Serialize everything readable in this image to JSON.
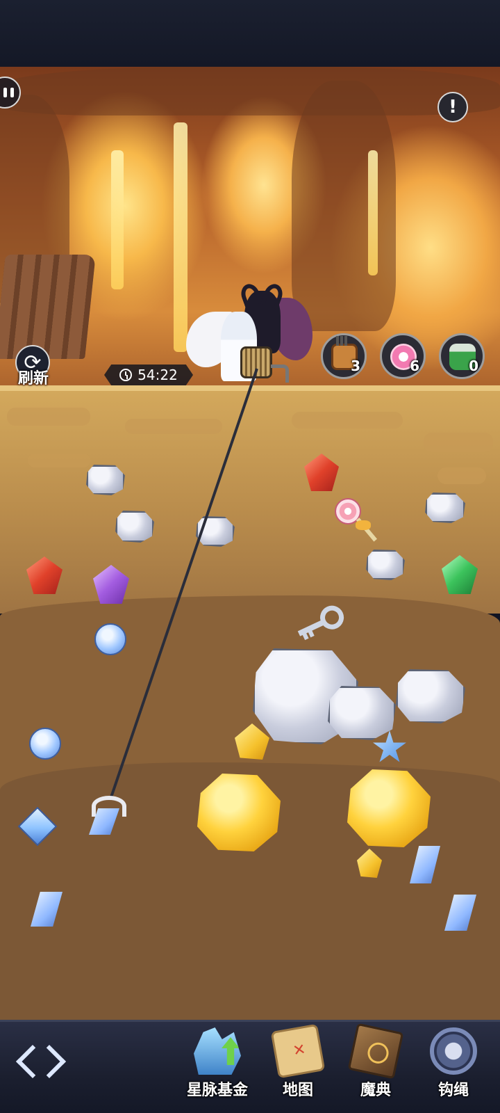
{
  "hud": {
    "refresh_label": "刷新",
    "timer": "54:22",
    "items": [
      {
        "name": "dynamite",
        "count": "3"
      },
      {
        "name": "candy",
        "count": "6"
      },
      {
        "name": "potion-can",
        "count": "0"
      }
    ]
  },
  "nav": {
    "items": [
      {
        "label": "星脉基金",
        "icon": "fund-icon"
      },
      {
        "label": "地图",
        "icon": "map-icon"
      },
      {
        "label": "魔典",
        "icon": "book-icon"
      },
      {
        "label": "钩绳",
        "icon": "hook-rope-icon"
      }
    ]
  },
  "colors": {
    "soil_top": "#d3a85c",
    "soil_mid": "#8a6239",
    "soil_deep": "#7c5836",
    "nav_bg": "#1b1f2f"
  }
}
